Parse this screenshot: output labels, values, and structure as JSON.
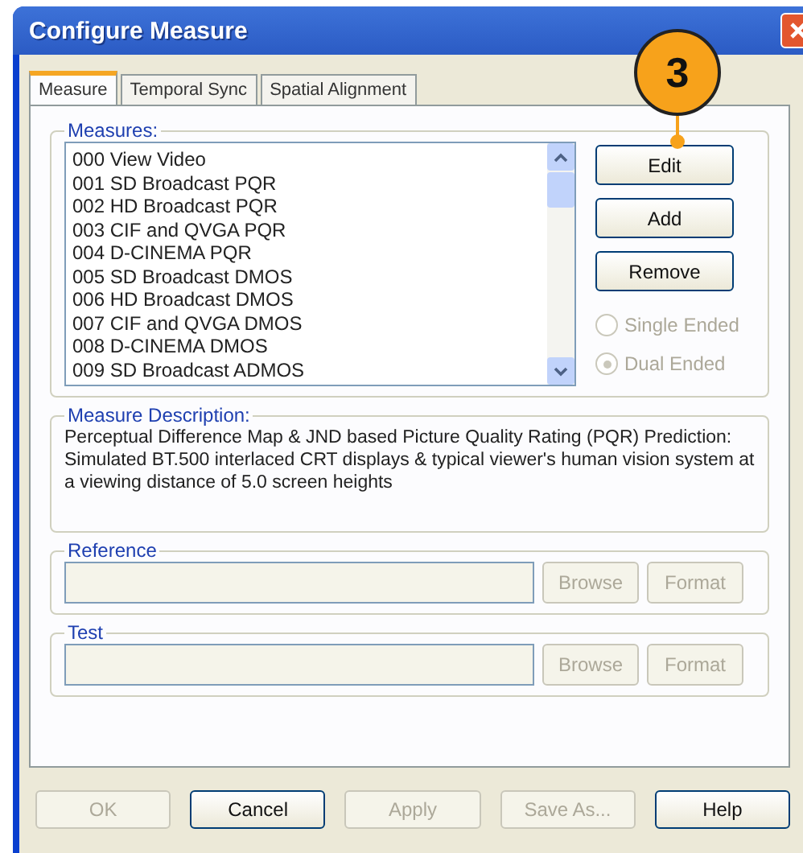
{
  "window": {
    "title": "Configure Measure"
  },
  "callout": {
    "label": "3"
  },
  "tabs": [
    {
      "label": "Measure",
      "selected": true
    },
    {
      "label": "Temporal Sync",
      "selected": false
    },
    {
      "label": "Spatial Alignment",
      "selected": false
    }
  ],
  "measures": {
    "label": "Measures:",
    "items": [
      {
        "label": "000 View Video",
        "selected": false
      },
      {
        "label": "001 SD Broadcast PQR",
        "selected": false
      },
      {
        "label": "002 HD Broadcast PQR",
        "selected": false
      },
      {
        "label": "003 CIF and QVGA PQR",
        "selected": false
      },
      {
        "label": "004 D-CINEMA PQR",
        "selected": false
      },
      {
        "label": "005 SD Broadcast DMOS",
        "selected": false
      },
      {
        "label": "006 HD Broadcast DMOS",
        "selected": false
      },
      {
        "label": "007 CIF and QVGA DMOS",
        "selected": false
      },
      {
        "label": "008 D-CINEMA DMOS",
        "selected": false
      },
      {
        "label": "009 SD Broadcast ADMOS",
        "selected": false
      }
    ],
    "buttons": [
      {
        "label": "Edit",
        "disabled": false
      },
      {
        "label": "Add",
        "disabled": false
      },
      {
        "label": "Remove",
        "disabled": false
      }
    ],
    "radios": [
      {
        "label": "Single Ended",
        "selected": false,
        "disabled": true
      },
      {
        "label": "Dual Ended",
        "selected": true,
        "disabled": true
      }
    ]
  },
  "description": {
    "label": "Measure Description:",
    "text": "Perceptual Difference Map & JND based Picture Quality Rating  (PQR) Prediction:  Simulated BT.500 interlaced CRT displays & typical viewer's human vision system at a viewing distance of 5.0 screen heights"
  },
  "files": [
    {
      "label": "Reference",
      "disabled": true,
      "buttons": [
        {
          "label": "Browse",
          "disabled": true
        },
        {
          "label": "Format",
          "disabled": true
        }
      ]
    },
    {
      "label": "Test",
      "disabled": true,
      "buttons": [
        {
          "label": "Browse",
          "disabled": true
        },
        {
          "label": "Format",
          "disabled": true
        }
      ]
    }
  ],
  "footer": [
    {
      "label": "OK",
      "disabled": true
    },
    {
      "label": "Cancel",
      "disabled": false
    },
    {
      "label": "Apply",
      "disabled": true
    },
    {
      "label": "Save As...",
      "disabled": true
    },
    {
      "label": "Help",
      "disabled": false
    }
  ]
}
